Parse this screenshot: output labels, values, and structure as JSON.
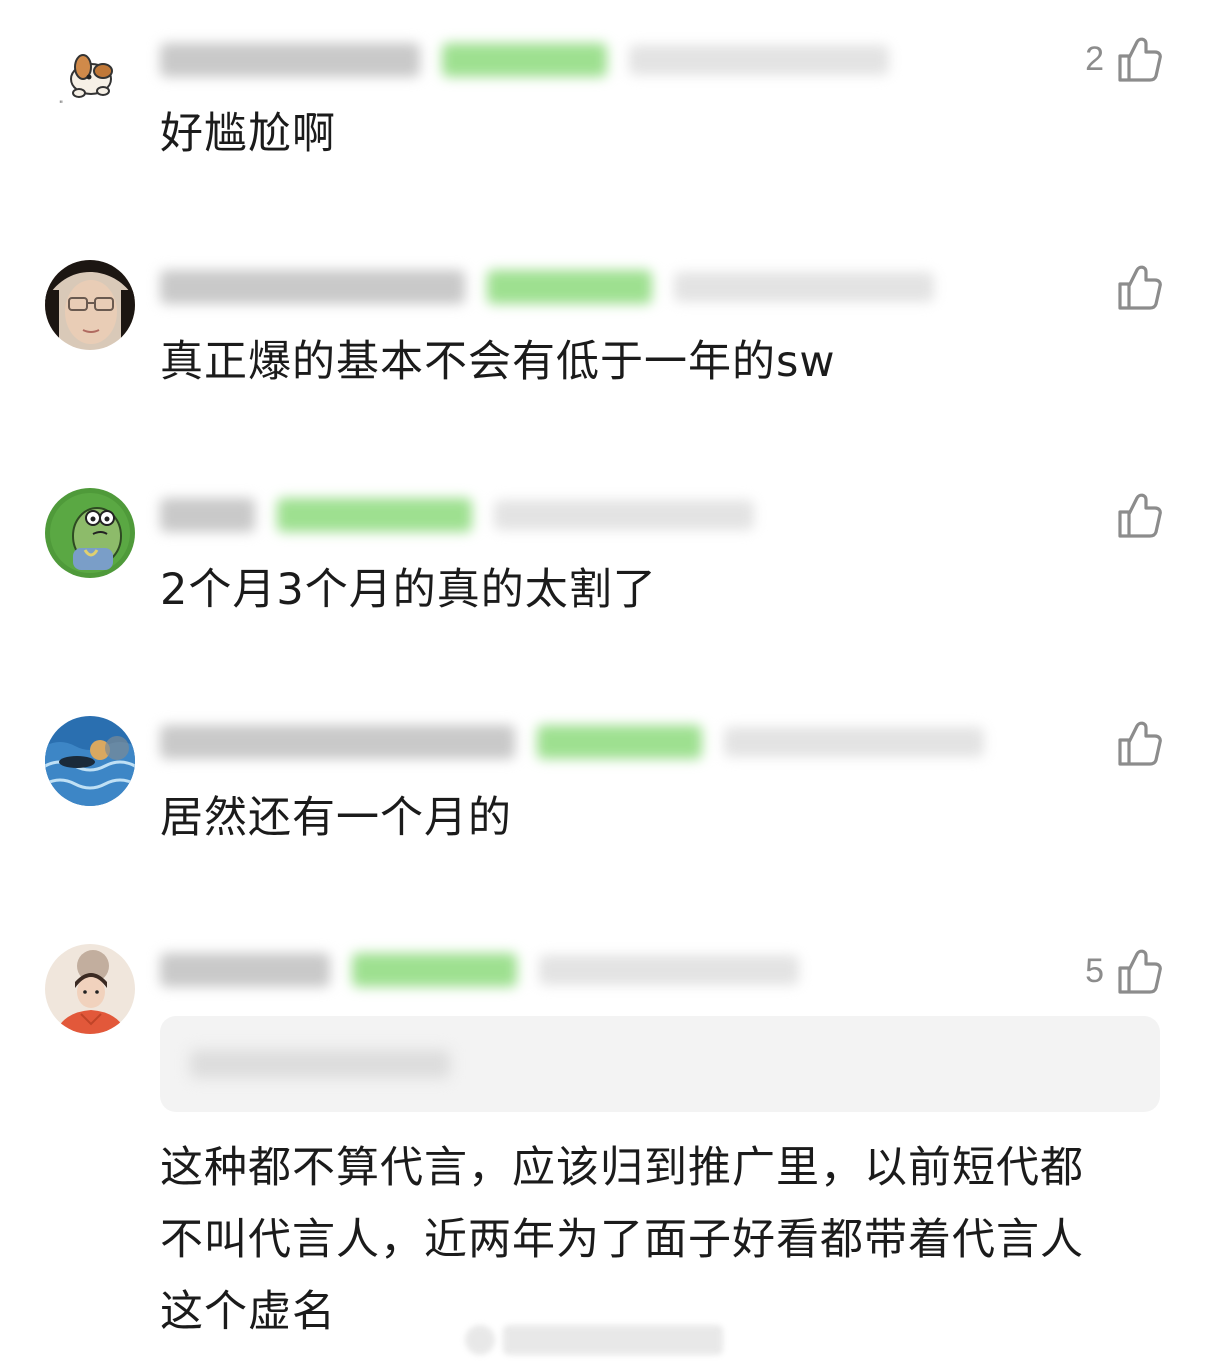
{
  "comments": [
    {
      "avatar_icon": "cartoon-dog-avatar",
      "likes": "2",
      "text": "好尴尬啊"
    },
    {
      "avatar_icon": "woman-glasses-avatar",
      "likes": "",
      "text": "真正爆的基本不会有低于一年的sw"
    },
    {
      "avatar_icon": "cartoon-fish-avatar",
      "likes": "",
      "text": "2个月3个月的真的太割了"
    },
    {
      "avatar_icon": "ocean-swimmer-avatar",
      "likes": "",
      "text": "居然还有一个月的"
    },
    {
      "avatar_icon": "illustrated-girl-avatar",
      "likes": "5",
      "text": "这种都不算代言，应该归到推广里，以前短代都\n不叫代言人，近两年为了面子好看都带着代言人\n这个虚名"
    }
  ],
  "icons": {
    "like": "thumbs-up-icon"
  },
  "colors": {
    "like_icon": "#8c8c8c",
    "badge_green": "#9ee090",
    "quote_bg": "#f3f3f3"
  }
}
